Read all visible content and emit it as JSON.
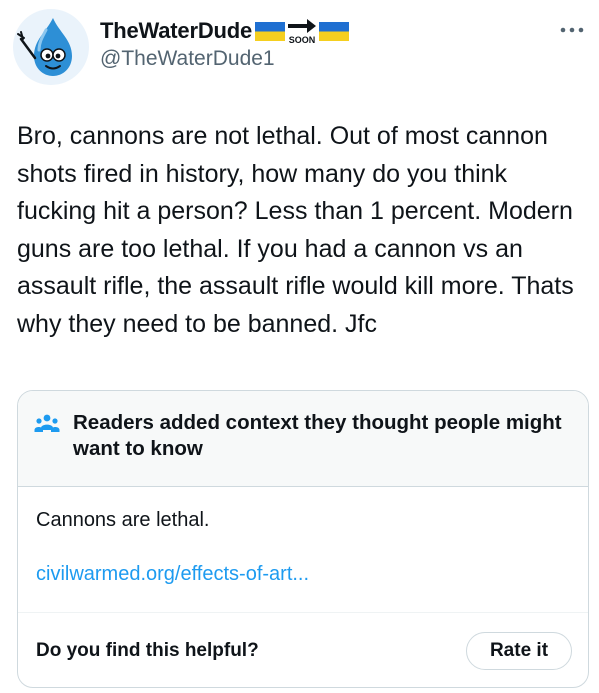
{
  "user": {
    "display_name": "TheWaterDude",
    "handle": "@TheWaterDude1",
    "badge_text": "SOON",
    "avatar_icon": "water-drop-character-icon",
    "flag_icon": "ukraine-flag-icon"
  },
  "tweet": {
    "text": "Bro, cannons are not lethal. Out of most cannon shots fired in history, how many do you think fucking hit a person? Less than 1 percent. Modern guns are too lethal. If you had a cannon vs an assault rifle, the assault rifle would kill more. Thats why they need to be banned. Jfc"
  },
  "note": {
    "title": "Readers added context they thought people might want to know",
    "body": "Cannons are lethal.",
    "link": "civilwarmed.org/effects-of-art...",
    "helpful_question": "Do you find this helpful?",
    "rate_label": "Rate it",
    "icon": "people-icon"
  },
  "colors": {
    "text": "#0f1419",
    "secondary": "#536471",
    "link": "#1d9bf0",
    "border": "#cfd9de",
    "note_bg": "#f7f9f9",
    "avatar_blue": "#2d8fd6",
    "flag_blue": "#1f6fd1",
    "flag_yellow": "#f5cf1f"
  }
}
